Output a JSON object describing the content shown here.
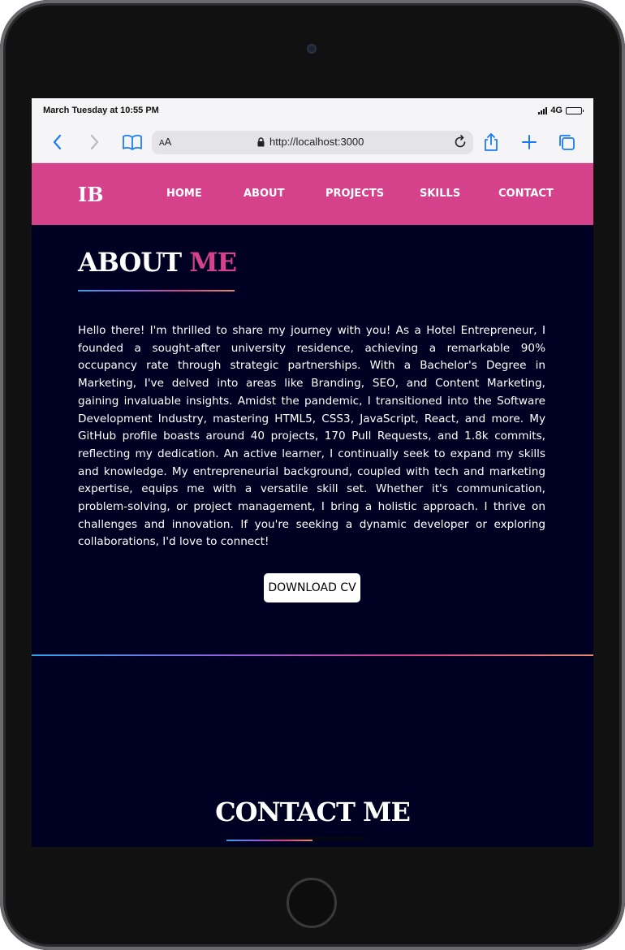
{
  "status_bar": {
    "datetime": "March Tuesday at 10:55 PM",
    "network": "4G"
  },
  "browser": {
    "text_size_label": "AA",
    "url": "http://localhost:3000",
    "icons": [
      "chevron-left-icon",
      "chevron-right-icon",
      "book-icon",
      "lock-icon",
      "reload-icon",
      "share-icon",
      "plus-icon",
      "tabs-icon"
    ]
  },
  "site": {
    "logo": "IB",
    "nav": {
      "home": "HOME",
      "about": "ABOUT",
      "projects": "PROJECTS",
      "skills": "SKILLS",
      "contact": "CONTACT"
    },
    "about": {
      "title_main": "ABOUT ",
      "title_accent": "ME",
      "body": "Hello there! I'm thrilled to share my journey with you! As a Hotel Entrepreneur, I founded a sought-after university residence, achieving a remarkable 90% occupancy rate through strategic partnerships. With a Bachelor's Degree in Marketing, I've delved into areas like Branding, SEO, and Content Marketing, gaining invaluable insights. Amidst the pandemic, I transitioned into the Software Development Industry, mastering HTML5, CSS3, JavaScript, React, and more. My GitHub profile boasts around 40 projects, 170 Pull Requests, and 1.8k commits, reflecting my dedication. An active learner, I continually seek to expand my skills and knowledge. My entrepreneurial background, coupled with tech and marketing expertise, equips me with a versatile skill set. Whether it's communication, problem-solving, or project management, I bring a holistic approach. I thrive on challenges and innovation. If you're seeking a dynamic developer or exploring collaborations, I'd love to connect!",
      "download_button": "DOWNLOAD CV"
    },
    "contact": {
      "title": "CONTACT ME"
    }
  },
  "colors": {
    "brand_pink": "#d6418c",
    "background_navy": "#000022",
    "gradient": [
      "#2aa6e8",
      "#8c62e0",
      "#d6418c",
      "#e08a70"
    ]
  }
}
